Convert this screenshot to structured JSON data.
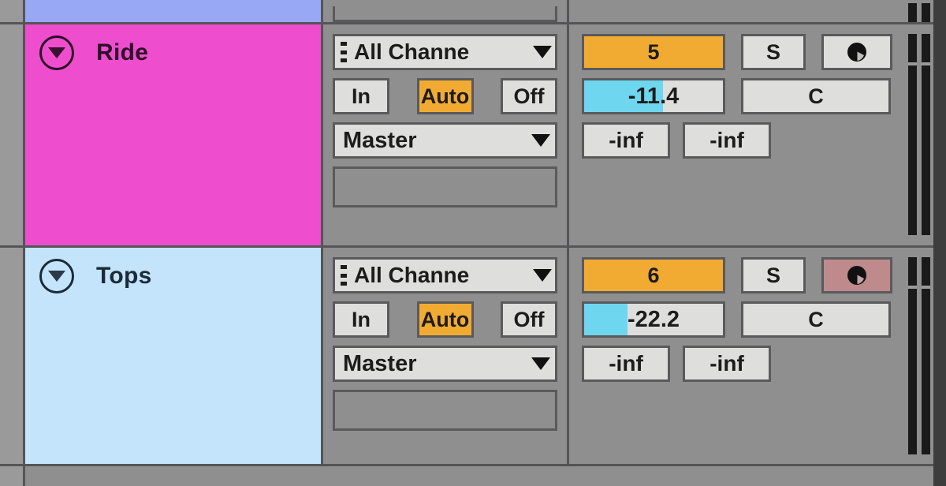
{
  "app": {
    "view": "session-view-track-headers",
    "background_color": "#8f8f8f",
    "border_color": "#555557"
  },
  "partial_top_track": {
    "name": "",
    "color": "#99a8f5",
    "slot_stub": ""
  },
  "partial_bottom_track": {
    "name": "",
    "color": "#8f8f8f"
  },
  "tracks": [
    {
      "id": "ride",
      "name": "Ride",
      "color": "#ee4ece",
      "text_color": "#2d0d27",
      "fold_icon": "triangle-down-icon",
      "io": {
        "input_handle_icon": "drag-dots-icon",
        "input_label": "All Channe",
        "input_caret_icon": "chevron-down-icon",
        "monitor": {
          "in_label": "In",
          "auto_label": "Auto",
          "off_label": "Off",
          "selected": "Auto",
          "active_color": "#f2ab32"
        },
        "output_label": "Master",
        "output_caret_icon": "chevron-down-icon",
        "clip_slot_label": ""
      },
      "mixer": {
        "activator_label": "5",
        "activator_color": "#f2ab32",
        "activator_on": true,
        "solo_label": "S",
        "solo_on": false,
        "arm_icon": "record-arm-icon",
        "arm_on": false,
        "arm_color": "#cccccc",
        "volume_label": "-11.4",
        "volume_fill_percent": 57,
        "volume_fill_color": "#6ed6ef",
        "pan_label": "C",
        "sends": [
          "-inf",
          "-inf"
        ],
        "meter": {
          "left_level": 0,
          "right_level": 0,
          "color": "#1a1a1a"
        }
      }
    },
    {
      "id": "tops",
      "name": "Tops",
      "color": "#c3e4fa",
      "text_color": "#1c2b38",
      "fold_icon": "triangle-down-icon",
      "io": {
        "input_handle_icon": "drag-dots-icon",
        "input_label": "All Channe",
        "input_caret_icon": "chevron-down-icon",
        "monitor": {
          "in_label": "In",
          "auto_label": "Auto",
          "off_label": "Off",
          "selected": "Auto",
          "active_color": "#f2ab32"
        },
        "output_label": "Master",
        "output_caret_icon": "chevron-down-icon",
        "clip_slot_label": ""
      },
      "mixer": {
        "activator_label": "6",
        "activator_color": "#f2ab32",
        "activator_on": true,
        "solo_label": "S",
        "solo_on": false,
        "arm_icon": "record-arm-icon",
        "arm_on": true,
        "arm_color": "#bf8a8c",
        "volume_label": "-22.2",
        "volume_fill_percent": 31,
        "volume_fill_color": "#6ed6ef",
        "pan_label": "C",
        "sends": [
          "-inf",
          "-inf"
        ],
        "meter": {
          "left_level": 0,
          "right_level": 0,
          "color": "#1a1a1a"
        }
      }
    }
  ]
}
